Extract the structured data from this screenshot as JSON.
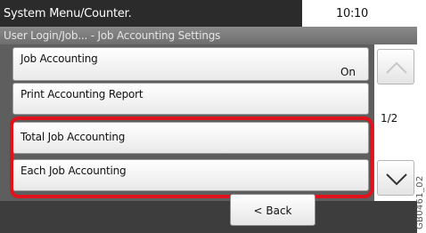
{
  "status": {
    "title": "System Menu/Counter.",
    "time": "10:10"
  },
  "breadcrumb": "User Login/Job... - Job Accounting Settings",
  "list": {
    "items": [
      {
        "label": "Job Accounting",
        "value": "On"
      },
      {
        "label": "Print Accounting Report"
      },
      {
        "label": "Total Job Accounting"
      },
      {
        "label": "Each Job Accounting"
      }
    ]
  },
  "pager": {
    "indicator": "1/2",
    "up_icon": "chevron-up-icon",
    "down_icon": "chevron-down-icon"
  },
  "footer": {
    "back_label": "< Back"
  },
  "figure_code": "GB0461_02",
  "colors": {
    "highlight": "#e0121c",
    "status_bar": "#2b2b2b",
    "content_bg": "#5e5e5e"
  }
}
